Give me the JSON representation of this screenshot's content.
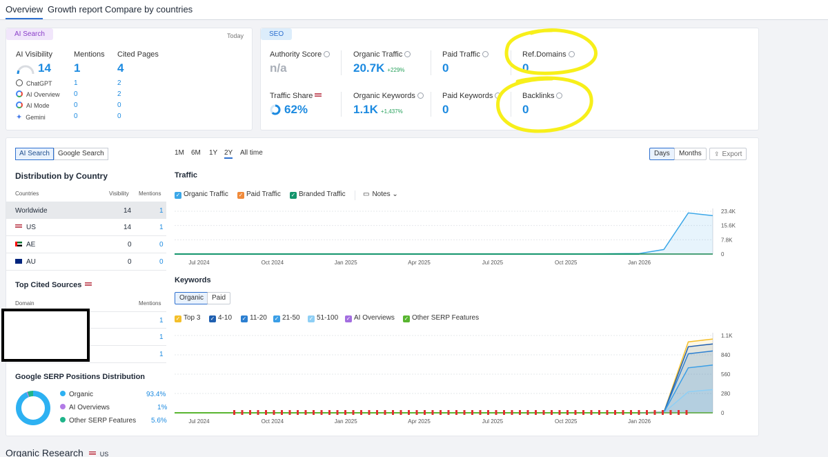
{
  "tabs": [
    {
      "label": "Overview"
    },
    {
      "label": "Growth report"
    },
    {
      "label": "Compare by countries"
    }
  ],
  "ai_card": {
    "badge": "AI Search",
    "date": "Today",
    "visibility_label": "AI Visibility",
    "visibility_value": "14",
    "visibility_gauge": 0.14,
    "mentions_label": "Mentions",
    "mentions_value": "1",
    "cited_label": "Cited Pages",
    "cited_value": "4",
    "engines": [
      {
        "name": "ChatGPT",
        "icon": "chatgpt-icon",
        "mentions": "1",
        "cited": "2"
      },
      {
        "name": "AI Overview",
        "icon": "google-icon",
        "mentions": "0",
        "cited": "2"
      },
      {
        "name": "AI Mode",
        "icon": "google-icon",
        "mentions": "0",
        "cited": "0"
      },
      {
        "name": "Gemini",
        "icon": "gemini-icon",
        "mentions": "0",
        "cited": "0"
      }
    ]
  },
  "seo_card": {
    "badge": "SEO",
    "authority_label": "Authority Score",
    "authority_value": "n/a",
    "organic_traffic_label": "Organic Traffic",
    "organic_traffic_value": "20.7K",
    "organic_traffic_delta": "+229%",
    "paid_traffic_label": "Paid Traffic",
    "paid_traffic_value": "0",
    "ref_domains_label": "Ref.Domains",
    "ref_domains_value": "0",
    "traffic_share_label": "Traffic Share",
    "traffic_share_value": "62%",
    "traffic_share_fraction": 0.62,
    "organic_kw_label": "Organic Keywords",
    "organic_kw_value": "1.1K",
    "organic_kw_delta": "+1,437%",
    "paid_kw_label": "Paid Keywords",
    "paid_kw_value": "0",
    "backlinks_label": "Backlinks",
    "backlinks_value": "0",
    "highlight_color": "#f7ef1a"
  },
  "left_panel": {
    "toggle": [
      "AI Search",
      "Google Search"
    ],
    "country_title": "Distribution by Country",
    "country_headers": [
      "Countries",
      "Visibility",
      "Mentions"
    ],
    "countries": [
      {
        "name": "Worldwide",
        "visibility": "14",
        "mentions": "1"
      },
      {
        "name": "US",
        "visibility": "14",
        "mentions": "1"
      },
      {
        "name": "AE",
        "visibility": "0",
        "mentions": "0"
      },
      {
        "name": "AU",
        "visibility": "0",
        "mentions": "0"
      }
    ],
    "sources_title": "Top Cited Sources",
    "sources_headers": [
      "Domain",
      "Mentions"
    ],
    "sources": [
      {
        "mentions": "1"
      },
      {
        "mentions": "1"
      },
      {
        "mentions": "1"
      }
    ],
    "serp_title": "Google SERP Positions Distribution",
    "serp": [
      {
        "label": "Organic",
        "value": "93.4%",
        "color": "#2db1f2"
      },
      {
        "label": "AI Overviews",
        "value": "1%",
        "color": "#b27be6"
      },
      {
        "label": "Other SERP Features",
        "value": "5.6%",
        "color": "#1fb48a"
      }
    ]
  },
  "periods": [
    "1M",
    "6M",
    "1Y",
    "2Y",
    "All time"
  ],
  "view_toggle": [
    "Days",
    "Months"
  ],
  "export_label": "Export",
  "traffic": {
    "title": "Traffic",
    "legend": [
      {
        "label": "Organic Traffic",
        "color": "#3ba7e8"
      },
      {
        "label": "Paid Traffic",
        "color": "#f08a3a"
      },
      {
        "label": "Branded Traffic",
        "color": "#13956c"
      }
    ],
    "notes_label": "Notes"
  },
  "keywords": {
    "title": "Keywords",
    "toggle": [
      "Organic",
      "Paid"
    ],
    "legend": [
      {
        "label": "Top 3",
        "color": "#f4bf2a"
      },
      {
        "label": "4-10",
        "color": "#1f5fb0"
      },
      {
        "label": "11-20",
        "color": "#2c7fd1"
      },
      {
        "label": "21-50",
        "color": "#3a9ee6"
      },
      {
        "label": "51-100",
        "color": "#8ecff5"
      },
      {
        "label": "AI Overviews",
        "color": "#a36ee0"
      },
      {
        "label": "Other SERP Features",
        "color": "#58b530"
      }
    ]
  },
  "x_ticks": [
    "Jul 2024",
    "Oct 2024",
    "Jan 2025",
    "Apr 2025",
    "Jul 2025",
    "Oct 2025",
    "Jan 2026"
  ],
  "chart_data": [
    {
      "type": "area",
      "title": "Traffic",
      "y_ticks": [
        "23.4K",
        "15.6K",
        "7.8K",
        "0"
      ],
      "ylim": [
        0,
        23400
      ],
      "series": [
        {
          "name": "Organic Traffic",
          "x": [
            "Jul 2024",
            "Oct 2024",
            "Jan 2025",
            "Apr 2025",
            "Jul 2025",
            "Oct 2025",
            "Jan 2026",
            "Feb 2026",
            "Mar 2026",
            "Apr 2026"
          ],
          "values": [
            0,
            0,
            0,
            0,
            0,
            0,
            300,
            2500,
            22500,
            21000
          ]
        },
        {
          "name": "Paid Traffic",
          "x": [
            "Jul 2024",
            "Jan 2026",
            "Apr 2026"
          ],
          "values": [
            0,
            0,
            0
          ]
        },
        {
          "name": "Branded Traffic",
          "x": [
            "Jul 2024",
            "Jan 2026",
            "Apr 2026"
          ],
          "values": [
            0,
            0,
            0
          ]
        }
      ]
    },
    {
      "type": "area",
      "title": "Keywords",
      "y_ticks": [
        "1.1K",
        "840",
        "560",
        "280",
        "0"
      ],
      "ylim": [
        0,
        1100
      ],
      "series": [
        {
          "name": "Top 3",
          "x": [
            "Jan 2026",
            "Feb 2026",
            "Mar 2026",
            "Apr 2026"
          ],
          "values": [
            0,
            10,
            1010,
            1050
          ]
        },
        {
          "name": "4-10",
          "x": [
            "Jan 2026",
            "Feb 2026",
            "Mar 2026",
            "Apr 2026"
          ],
          "values": [
            0,
            8,
            940,
            980
          ]
        },
        {
          "name": "11-20",
          "x": [
            "Jan 2026",
            "Feb 2026",
            "Mar 2026",
            "Apr 2026"
          ],
          "values": [
            0,
            6,
            840,
            880
          ]
        },
        {
          "name": "21-50",
          "x": [
            "Jan 2026",
            "Feb 2026",
            "Mar 2026",
            "Apr 2026"
          ],
          "values": [
            0,
            4,
            640,
            680
          ]
        },
        {
          "name": "51-100",
          "x": [
            "Jan 2026",
            "Feb 2026",
            "Mar 2026",
            "Apr 2026"
          ],
          "values": [
            0,
            2,
            300,
            330
          ]
        },
        {
          "name": "AI Overviews",
          "x": [
            "Jan 2026",
            "Apr 2026"
          ],
          "values": [
            0,
            0
          ]
        },
        {
          "name": "Other SERP Features",
          "x": [
            "Jan 2026",
            "Apr 2026"
          ],
          "values": [
            0,
            0
          ]
        }
      ]
    }
  ],
  "organic_research": {
    "title": "Organic Research",
    "country": "US"
  }
}
